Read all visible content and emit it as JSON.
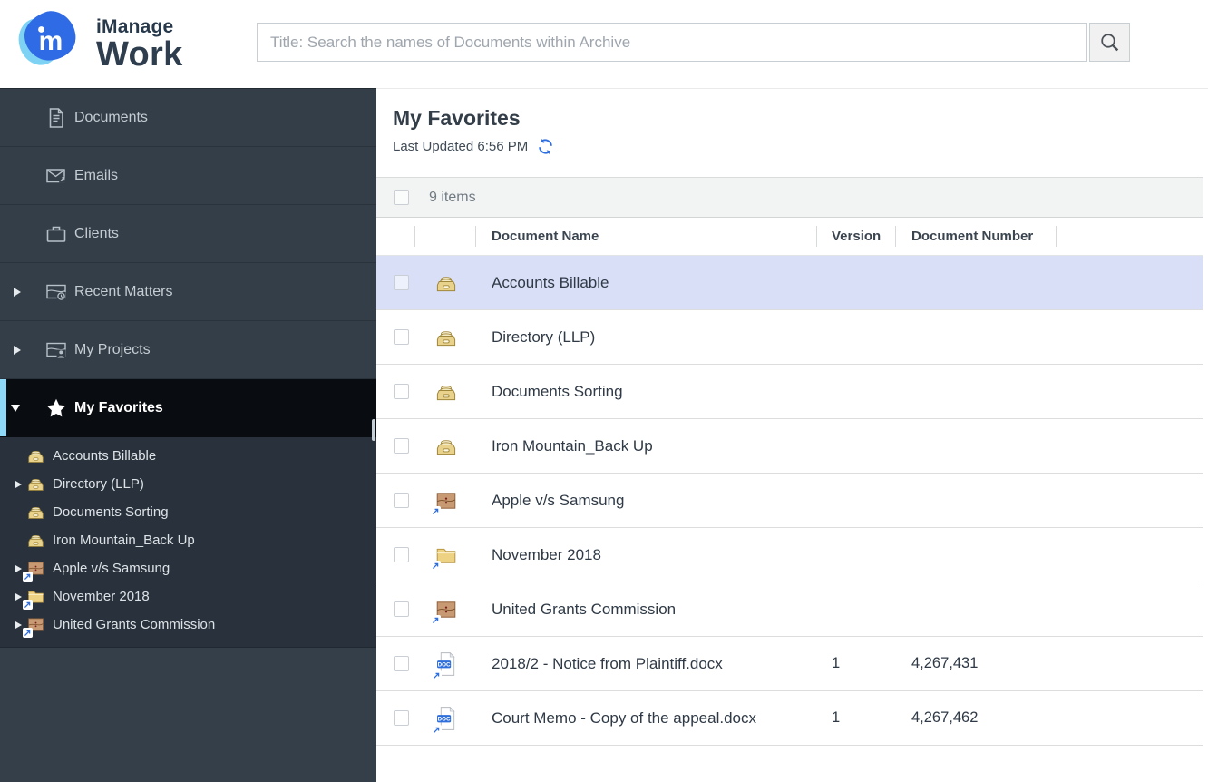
{
  "header": {
    "brand": {
      "name": "iManage",
      "product": "Work"
    },
    "search": {
      "placeholder": "Title: Search the names of Documents within Archive",
      "button_icon": "magnifier-icon"
    }
  },
  "sidebar": {
    "items": [
      {
        "label": "Documents",
        "icon": "document-icon",
        "expandable": false,
        "selected": false
      },
      {
        "label": "Emails",
        "icon": "email-icon",
        "expandable": false,
        "selected": false
      },
      {
        "label": "Clients",
        "icon": "briefcase-icon",
        "expandable": false,
        "selected": false
      },
      {
        "label": "Recent Matters",
        "icon": "matter-clock-icon",
        "expandable": true,
        "selected": false
      },
      {
        "label": "My Projects",
        "icon": "matter-person-icon",
        "expandable": true,
        "selected": false
      },
      {
        "label": "My Favorites",
        "icon": "star-icon",
        "expandable": true,
        "expanded": true,
        "selected": true
      }
    ],
    "tree": [
      {
        "label": "Accounts Billable",
        "icon": "file-drawer-icon",
        "expandable": false,
        "shortcut": false
      },
      {
        "label": "Directory (LLP)",
        "icon": "file-drawer-icon",
        "expandable": true,
        "shortcut": false
      },
      {
        "label": "Documents Sorting",
        "icon": "file-drawer-icon",
        "expandable": false,
        "shortcut": false
      },
      {
        "label": "Iron Mountain_Back Up",
        "icon": "file-drawer-icon",
        "expandable": false,
        "shortcut": false
      },
      {
        "label": "Apple v/s Samsung",
        "icon": "workspace-icon",
        "expandable": true,
        "shortcut": true
      },
      {
        "label": "November 2018",
        "icon": "folder-icon",
        "expandable": true,
        "shortcut": true
      },
      {
        "label": "United Grants Commission",
        "icon": "workspace-icon",
        "expandable": true,
        "shortcut": true
      }
    ]
  },
  "main": {
    "title": "My Favorites",
    "last_updated": "Last Updated 6:56 PM",
    "items_count": "9 items",
    "table": {
      "columns": [
        "Document Name",
        "Version",
        "Document Number"
      ],
      "rows": [
        {
          "name": "Accounts Billable",
          "icon": "file-drawer-icon",
          "shortcut": false,
          "version": "",
          "number": "",
          "selected": true
        },
        {
          "name": "Directory (LLP)",
          "icon": "file-drawer-icon",
          "shortcut": false,
          "version": "",
          "number": "",
          "selected": false
        },
        {
          "name": "Documents Sorting",
          "icon": "file-drawer-icon",
          "shortcut": false,
          "version": "",
          "number": "",
          "selected": false
        },
        {
          "name": "Iron Mountain_Back Up",
          "icon": "file-drawer-icon",
          "shortcut": false,
          "version": "",
          "number": "",
          "selected": false
        },
        {
          "name": "Apple v/s Samsung",
          "icon": "workspace-icon",
          "shortcut": true,
          "version": "",
          "number": "",
          "selected": false
        },
        {
          "name": "November 2018",
          "icon": "folder-icon",
          "shortcut": true,
          "version": "",
          "number": "",
          "selected": false
        },
        {
          "name": "United Grants Commission",
          "icon": "workspace-icon",
          "shortcut": true,
          "version": "",
          "number": "",
          "selected": false
        },
        {
          "name": "2018/2 - Notice from Plaintiff.docx",
          "icon": "doc-file-icon",
          "shortcut": true,
          "version": "1",
          "number": "4,267,431",
          "selected": false
        },
        {
          "name": "Court Memo - Copy of the appeal.docx",
          "icon": "doc-file-icon",
          "shortcut": true,
          "version": "1",
          "number": "4,267,462",
          "selected": false
        }
      ]
    }
  },
  "icons": {
    "doc_badge": "DOC"
  },
  "colors": {
    "accent_blue": "#2d6ee0",
    "logo_blue": "#2f6be4",
    "logo_light_blue": "#7ed3f5",
    "sidebar_bg": "#333e48",
    "sidebar_tree_bg": "#29323c",
    "selected_nav_bg": "#090c10",
    "selected_nav_stripe": "#8ed9f8",
    "selected_row_bg": "#d8dff7",
    "items_bar_bg": "#f2f3f3"
  }
}
